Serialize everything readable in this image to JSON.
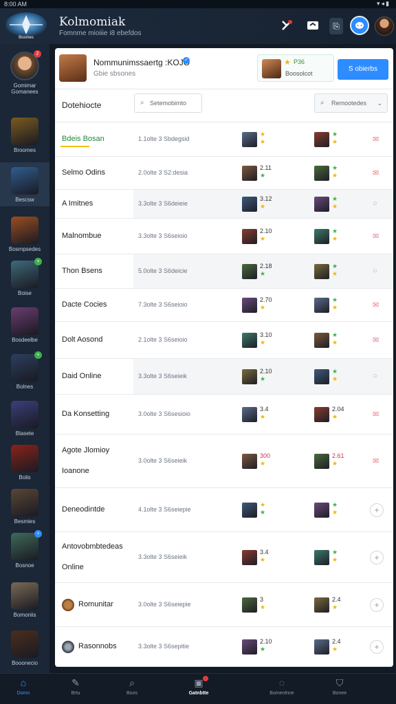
{
  "status": {
    "time": "8:00 AM",
    "icons": "▾◂▮"
  },
  "header": {
    "title": "Kolmomiak",
    "subtitle": "Fomnme mioiiie i8 ebefdos",
    "icons": [
      "puzzle-icon",
      "message-icon",
      "document-icon",
      "chat-bubble-icon",
      "profile-avatar"
    ]
  },
  "sidebar": {
    "items": [
      {
        "label": "Gomimar\nGomanees",
        "kind": "avatar",
        "badge": "2",
        "badge_color": "#e03a3a"
      },
      {
        "label": "Broomes",
        "kind": "thumb",
        "color": "#7a5b1e"
      },
      {
        "label": "Bescsw",
        "kind": "thumb",
        "color": "#2f5d8f",
        "active": true
      },
      {
        "label": "Bosmpsedes",
        "kind": "thumb",
        "color": "#9a4e22"
      },
      {
        "label": "Boise",
        "kind": "thumb",
        "color": "#3f6a7a",
        "badge": "+",
        "badge_color": "#3bb34a"
      },
      {
        "label": "Bosdeelbe",
        "kind": "thumb",
        "color": "#6a3d70"
      },
      {
        "label": "Bolnes",
        "kind": "thumb",
        "color": "#2c3f5e",
        "badge": "+",
        "badge_color": "#3bb34a"
      },
      {
        "label": "Blasete",
        "kind": "thumb",
        "color": "#3b3f7a"
      },
      {
        "label": "Bolis",
        "kind": "thumb",
        "color": "#8a2318"
      },
      {
        "label": "Besmies",
        "kind": "thumb",
        "color": "#5a4636"
      },
      {
        "label": "Bosnoe",
        "kind": "thumb",
        "color": "#3f6a5a",
        "badge": "+",
        "badge_color": "#2d8cff"
      },
      {
        "label": "Bomoniis",
        "kind": "thumb",
        "color": "#7a6a55"
      },
      {
        "label": "Booonecio",
        "kind": "thumb",
        "color": "#4a2e1e"
      }
    ]
  },
  "topcard": {
    "name": "Nommunimssaertg :KOJO",
    "sub": "Gbie sbsones",
    "rank_score": "P36",
    "rank_label": "Boosolcot",
    "cta": "S obierbs"
  },
  "filters": {
    "title": "Dotehiocte",
    "search": "Setemobimto",
    "sort": "Remootedes"
  },
  "rows": [
    {
      "name": "Bdeis Bosan",
      "detail": "1.1olte 3 Sbdegsid",
      "s1": "",
      "s2": "",
      "action": "mail",
      "highlight_name": true
    },
    {
      "name": "Selmo Odins",
      "detail": "2.0olte 3 S2:desia",
      "s1": "2.11",
      "s2": "",
      "action": "mail"
    },
    {
      "name": "A Imitnes",
      "detail": "3.3olte 3 S6deieie",
      "s1": "3.12",
      "s2": "",
      "action": "circle",
      "shaded": true
    },
    {
      "name": "Malnombue",
      "detail": "3.3olte 3 S6seioio",
      "s1": "2.10",
      "s2": "",
      "action": "mail"
    },
    {
      "name": "Thon Bsens",
      "detail": "5.0olte 3 S6deicie",
      "s1": "2.18",
      "s2": "",
      "action": "circle",
      "shaded": true
    },
    {
      "name": "Dacte Cocies",
      "detail": "7.3olte 3 S6seioio",
      "s1": "2.70",
      "s2": "",
      "action": "mail"
    },
    {
      "name": "Dolt Aosond",
      "detail": "2.1olte 3 S6seioio",
      "s1": "3.10",
      "s2": "",
      "action": "mail"
    },
    {
      "name": "Daid Online",
      "detail": "3.3olte 3 S6seieik",
      "s1": "2.10",
      "s2": "",
      "action": "circle",
      "shaded": true
    },
    {
      "name": "Da Konsetting",
      "detail": "3.0olte 3 S6sesioio",
      "s1": "3.4",
      "s2": "2.04",
      "action": "mail"
    },
    {
      "name": "Agote Jlomioy",
      "name2": "Ioanone",
      "detail": "3.0olte 3 S6seieik",
      "s1": "300",
      "s2": "2.61",
      "action": "mail",
      "red": true
    },
    {
      "name": "Deneodintde",
      "detail": "4.1olte 3 S6seiepie",
      "s1": "",
      "s2": "",
      "action": "plus"
    },
    {
      "name": "Antovobmbtedeas",
      "name2": "Online",
      "detail": "3.3olte 3 S6seieik",
      "s1": "3.4",
      "s2": "",
      "action": "plus"
    },
    {
      "name": "Romunitar",
      "detail": "3.0olte 3 S6seiepie",
      "s1": "3",
      "s2": "2.4",
      "action": "plus",
      "icon": true
    },
    {
      "name": "Rasonnobs",
      "detail": "3.3olte 3 S6sepitie",
      "s1": "2.10",
      "s2": "2.4",
      "action": "plus",
      "icon": true,
      "dark": true
    }
  ],
  "tabbar": [
    {
      "label": "Domn",
      "icon": "home-icon",
      "active": true
    },
    {
      "label": "Brtu",
      "icon": "edit-icon"
    },
    {
      "label": "Boos",
      "icon": "search-icon"
    },
    {
      "label": "Gatnbtte",
      "icon": "calendar-icon",
      "bold": true,
      "badge": true
    },
    {
      "label": "Bomenlnne",
      "icon": "chat-icon"
    },
    {
      "label": "Bonee",
      "icon": "shield-icon"
    }
  ]
}
